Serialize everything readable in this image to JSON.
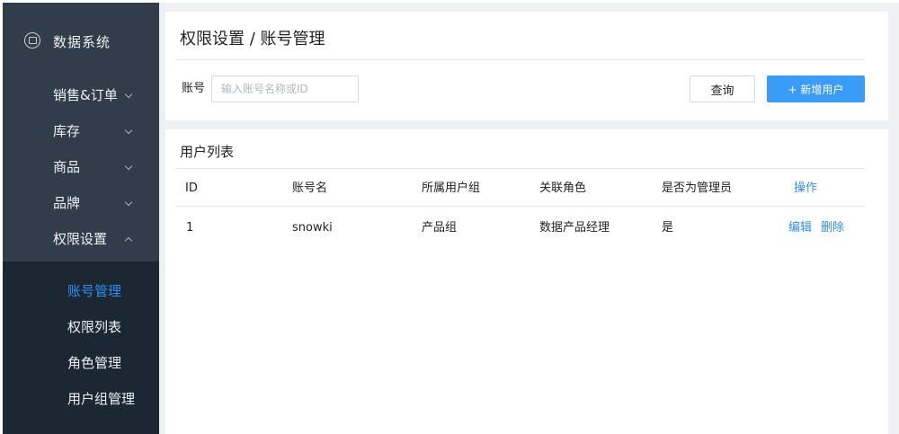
{
  "sidebar": {
    "brand": {
      "icon": "app-logo-icon",
      "title": "数据系统"
    },
    "menu": [
      {
        "label": "销售&订单",
        "chevron": "chevron-down-icon"
      },
      {
        "label": "库存",
        "chevron": "chevron-down-icon"
      },
      {
        "label": "商品",
        "chevron": "chevron-down-icon"
      },
      {
        "label": "品牌",
        "chevron": "chevron-down-icon"
      },
      {
        "label": "权限设置",
        "chevron": "chevron-up-icon",
        "expanded": true
      }
    ],
    "submenu": [
      {
        "label": "账号管理",
        "active": true
      },
      {
        "label": "权限列表"
      },
      {
        "label": "角色管理"
      },
      {
        "label": "用户组管理"
      }
    ]
  },
  "main": {
    "title": "权限设置 / 账号管理",
    "filter": {
      "label": "账号",
      "input": {
        "value": "",
        "placeholder": "输入账号名称或ID"
      },
      "query_button": "查询",
      "add_button": "+ 新增用户"
    },
    "list": {
      "title": "用户列表",
      "columns": [
        "ID",
        "账号名",
        "所属用户组",
        "关联角色",
        "是否为管理员",
        "操作"
      ],
      "rows": [
        {
          "id": "1",
          "name": "snowki",
          "group": "产品组",
          "role": "数据产品经理",
          "is_admin": "是",
          "actions": [
            "编辑",
            "删除"
          ]
        }
      ]
    }
  },
  "colors": {
    "sidebar_bg": "#313d4a",
    "submenu_bg": "#1c2734",
    "accent": "#2f8ef0",
    "primary_button": "#3a9cf6",
    "page_bg": "#eef0f3"
  }
}
